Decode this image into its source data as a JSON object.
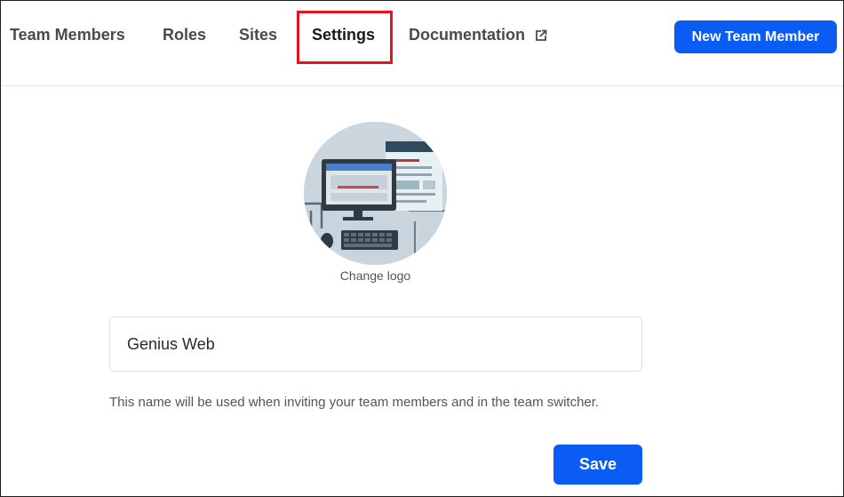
{
  "nav": {
    "tabs": [
      {
        "label": "Team Members"
      },
      {
        "label": "Roles"
      },
      {
        "label": "Sites"
      },
      {
        "label": "Settings",
        "active": true
      },
      {
        "label": "Documentation",
        "icon": "external-link-icon"
      }
    ],
    "new_member_label": "New Team Member"
  },
  "logo": {
    "icon": "computer-illustration",
    "change_label": "Change logo"
  },
  "form": {
    "team_name_value": "Genius Web",
    "helper_text": "This name will be used when inviting your team members and in the team switcher.",
    "save_label": "Save"
  },
  "colors": {
    "accent": "#0a5cf5",
    "highlight": "#e8141b",
    "logo_bg": "#c7d3dc"
  }
}
